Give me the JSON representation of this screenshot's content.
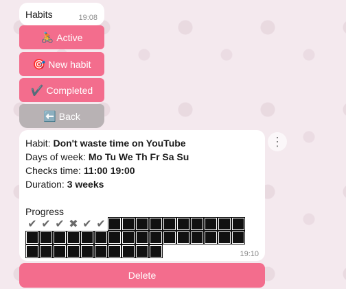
{
  "message1": {
    "title": "Habits",
    "time": "19:08"
  },
  "menu_buttons": [
    {
      "icon": "🚴",
      "label": "Active"
    },
    {
      "icon": "🎯",
      "label": "New habit"
    },
    {
      "icon": "✔️",
      "label": "Completed"
    },
    {
      "icon": "⬅️",
      "label": "Back"
    }
  ],
  "message2": {
    "habit_label": "Habit: ",
    "habit": "Don't waste time on YouTube",
    "days_label": "Days of week: ",
    "days": "Mo Tu We Th Fr Sa Su",
    "checks_label": "Checks time: ",
    "checks": "11:00 19:00",
    "duration_label": "Duration: ",
    "duration": "3 weeks",
    "progress_label": "Progress",
    "time": "19:10"
  },
  "progress": {
    "cells": [
      "check",
      "check",
      "check",
      "cross",
      "check",
      "check",
      "empty",
      "empty",
      "empty",
      "empty",
      "empty",
      "empty",
      "empty",
      "empty",
      "empty",
      "empty",
      "empty",
      "empty",
      "empty",
      "empty",
      "empty",
      "empty",
      "empty",
      "empty",
      "empty",
      "empty",
      "empty",
      "empty",
      "empty",
      "empty",
      "empty",
      "empty",
      "empty",
      "empty",
      "empty",
      "empty",
      "empty",
      "empty",
      "empty",
      "empty",
      "empty",
      "empty"
    ],
    "check_symbol": "✔",
    "cross_symbol": "✖"
  },
  "delete_button": {
    "label": "Delete"
  },
  "overflow_icon": "⋮"
}
